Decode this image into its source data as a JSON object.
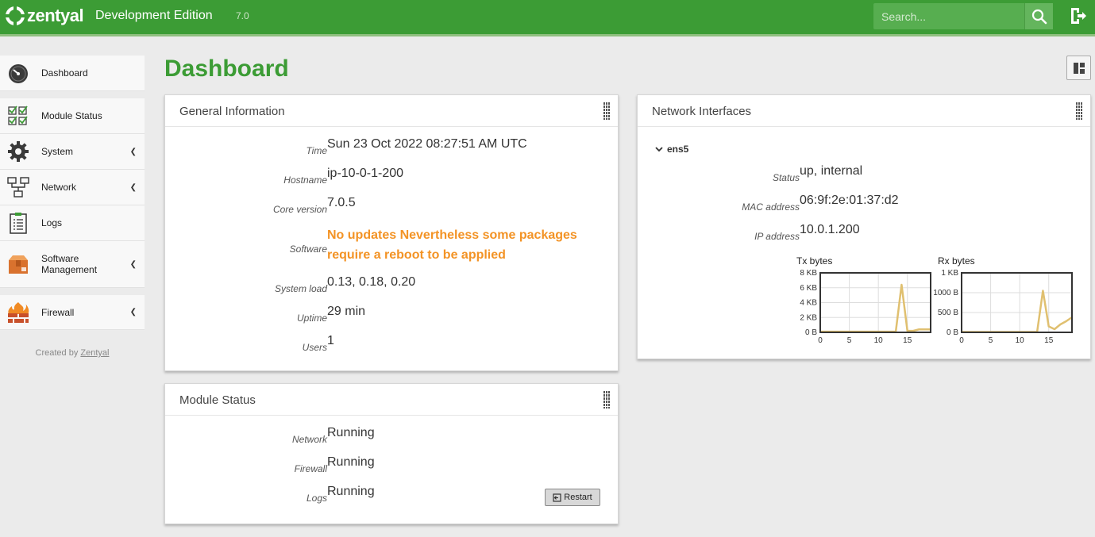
{
  "header": {
    "logo_text": "zentyal",
    "edition": "Development Edition",
    "version": "7.0",
    "search_placeholder": "Search...",
    "icons": {
      "search": "search-icon",
      "logout": "logout-icon"
    }
  },
  "sidebar": {
    "items": [
      {
        "label": "Dashboard",
        "icon": "gauge-icon",
        "expandable": false
      },
      {
        "label": "Module Status",
        "icon": "checklist-icon",
        "expandable": false
      },
      {
        "label": "System",
        "icon": "gear-icon",
        "expandable": true
      },
      {
        "label": "Network",
        "icon": "network-icon",
        "expandable": true
      },
      {
        "label": "Logs",
        "icon": "clipboard-icon",
        "expandable": false
      },
      {
        "label": "Software Management",
        "icon": "box-icon",
        "expandable": true
      },
      {
        "label": "Firewall",
        "icon": "firewall-icon",
        "expandable": true
      }
    ],
    "footer_prefix": "Created by ",
    "footer_link": "Zentyal"
  },
  "main": {
    "title": "Dashboard"
  },
  "general_info": {
    "title": "General Information",
    "rows": [
      {
        "label": "Time",
        "value": "Sun 23 Oct 2022 08:27:51 AM UTC"
      },
      {
        "label": "Hostname",
        "value": "ip-10-0-1-200"
      },
      {
        "label": "Core version",
        "value": "7.0.5"
      },
      {
        "label": "Software",
        "value": "No updates Nevertheless some packages require a reboot to be applied"
      },
      {
        "label": "System load",
        "value": "0.13, 0.18, 0.20"
      },
      {
        "label": "Uptime",
        "value": "29 min"
      },
      {
        "label": "Users",
        "value": "1"
      }
    ],
    "warn_color": "#f39325"
  },
  "module_status": {
    "title": "Module Status",
    "rows": [
      {
        "label": "Network",
        "value": "Running"
      },
      {
        "label": "Firewall",
        "value": "Running"
      },
      {
        "label": "Logs",
        "value": "Running"
      }
    ],
    "restart_label": "Restart"
  },
  "network": {
    "title": "Network Interfaces",
    "interface": "ens5",
    "rows": [
      {
        "label": "Status",
        "value": "up, internal"
      },
      {
        "label": "MAC address",
        "value": "06:9f:2e:01:37:d2"
      },
      {
        "label": "IP address",
        "value": "10.0.1.200"
      }
    ]
  },
  "chart_data": [
    {
      "type": "line",
      "title": "Tx bytes",
      "x": [
        0,
        1,
        2,
        3,
        4,
        5,
        6,
        7,
        8,
        9,
        10,
        11,
        12,
        13,
        14,
        15,
        16,
        17,
        18,
        19
      ],
      "values": [
        0.1,
        0.1,
        0.1,
        0.1,
        0.1,
        0.1,
        0.1,
        0.1,
        0.1,
        0.1,
        0.1,
        0.1,
        0.1,
        0.1,
        6.4,
        0.2,
        0.2,
        0.4,
        0.4,
        0.4
      ],
      "ytick_labels": [
        "0 B",
        "2 KB",
        "4 KB",
        "6 KB",
        "8 KB"
      ],
      "ytick_values": [
        0,
        2,
        4,
        6,
        8
      ],
      "xticks": [
        0,
        5,
        10,
        15
      ],
      "xlim": [
        0,
        19
      ],
      "ylim": [
        0,
        8
      ],
      "grid": true,
      "color": "#e0c070"
    },
    {
      "type": "line",
      "title": "Rx bytes",
      "x": [
        0,
        1,
        2,
        3,
        4,
        5,
        6,
        7,
        8,
        9,
        10,
        11,
        12,
        13,
        14,
        15,
        16,
        17,
        18,
        19
      ],
      "values": [
        10,
        10,
        10,
        10,
        10,
        10,
        10,
        10,
        10,
        10,
        10,
        10,
        10,
        10,
        1050,
        150,
        80,
        200,
        280,
        380
      ],
      "ytick_labels": [
        "0 B",
        "500 B",
        "1000 B",
        "1 KB"
      ],
      "ytick_values": [
        0,
        500,
        1000,
        1500
      ],
      "xticks": [
        0,
        5,
        10,
        15
      ],
      "xlim": [
        0,
        19
      ],
      "ylim": [
        0,
        1500
      ],
      "grid": true,
      "color": "#e0c070"
    }
  ]
}
